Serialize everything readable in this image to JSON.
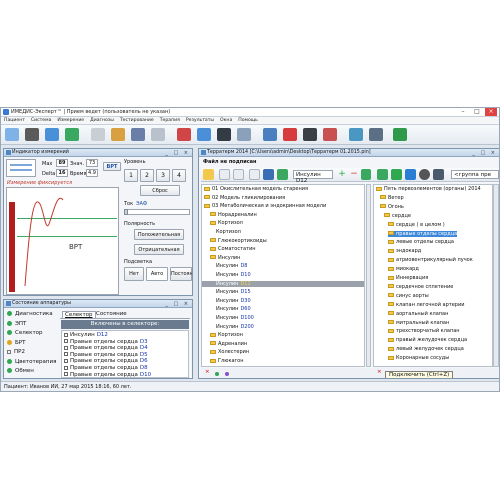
{
  "window": {
    "title": "ИМЕДИС-Эксперт™ | Прием ведет (пользователь не указан)"
  },
  "menu": [
    "Пациент",
    "Система",
    "Измерение",
    "Диагнозы",
    "Тестирование",
    "Терапия",
    "Результаты",
    "Окна",
    "Помощь"
  ],
  "indicator": {
    "title": "Индикатор измерений",
    "max_label": "Max",
    "max_value": "89",
    "value_label": "Знач.",
    "value_value": "73",
    "delta_label": "Delta",
    "delta_value": "16",
    "time_label": "Время",
    "time_value": "4.9",
    "brt_label": "ВРТ",
    "fixing_text": "Измерение фиксируется",
    "graph_label": "ВРТ",
    "level_label": "Уровень",
    "level_buttons": [
      "1",
      "2",
      "3",
      "4"
    ],
    "reset_label": "Сброс",
    "tok_label": "Ток",
    "eaf_label": "ЭАФ",
    "polarity_label": "Полярность",
    "positive_label": "Положительная",
    "negative_label": "Отрицательная",
    "backlight_label": "Подсветка",
    "backlight_options": [
      "Нет",
      "Авто",
      "Постоян."
    ]
  },
  "equipment": {
    "title": "Состояние аппаратуры",
    "items": [
      {
        "label": "Диагностика",
        "color": "#2fa84f"
      },
      {
        "label": "ЭПТ",
        "color": "#2fa84f"
      },
      {
        "label": "Селектор",
        "color": "#2fa84f"
      },
      {
        "label": "БРТ",
        "color": "#e0a51b"
      },
      {
        "label": "ПР2",
        "color": ""
      },
      {
        "label": "Цветотерапия",
        "color": "#2fa84f"
      },
      {
        "label": "Обмен",
        "color": "#2fa84f"
      }
    ],
    "tabs": [
      "Селектор",
      "Состояние"
    ],
    "selector_header": "Включены в селекторе:",
    "selector_items": [
      {
        "a": "Инсулин",
        "b": "D12"
      },
      {
        "a": "Правые отделы сердца",
        "b": "D3"
      },
      {
        "a": "Правые отделы сердца",
        "b": "D4"
      },
      {
        "a": "Правые отделы сердца",
        "b": "D5"
      },
      {
        "a": "Правые отделы сердца",
        "b": "D6"
      },
      {
        "a": "Правые отделы сердца",
        "b": "D8"
      },
      {
        "a": "Правые отделы сердца",
        "b": "D10"
      }
    ]
  },
  "terrain": {
    "title": "Терратерм 2014 [C:\\Users\\admin\\Desktop\\Терратерм 01.2015.pin]",
    "file_status": "Файл не подписан",
    "left_field": "Инсулин D12",
    "left_tree": [
      {
        "text": "01 Окислительная модель старения",
        "indent": 0,
        "folder": true,
        "color": ""
      },
      {
        "text": "02 Модель гликилирования",
        "indent": 0,
        "folder": true,
        "color": ""
      },
      {
        "text": "03 Метаболическая и эндокринная модели",
        "indent": 0,
        "folder": true,
        "color": ""
      },
      {
        "text": "Норадреналин",
        "indent": 1,
        "folder": true,
        "color": ""
      },
      {
        "text": "Кортизол",
        "indent": 1,
        "folder": true,
        "color": ""
      },
      {
        "text": "Кортизол",
        "indent": 2,
        "folder": false,
        "color": ""
      },
      {
        "text": "Глюкокортикоиды",
        "indent": 1,
        "folder": true,
        "color": ""
      },
      {
        "text": "Соматостатин",
        "indent": 1,
        "folder": true,
        "color": ""
      },
      {
        "text": "Инсулин",
        "indent": 1,
        "folder": true,
        "color": ""
      },
      {
        "text": "Инсулин",
        "indent": 2,
        "folder": false,
        "color": "",
        "code": "D8"
      },
      {
        "text": "Инсулин",
        "indent": 2,
        "folder": false,
        "color": "",
        "code": "D10"
      },
      {
        "text": "Инсулин",
        "indent": 2,
        "folder": false,
        "color": "",
        "code": "D12",
        "selected": true
      },
      {
        "text": "Инсулин",
        "indent": 2,
        "folder": false,
        "color": "",
        "code": "D15"
      },
      {
        "text": "Инсулин",
        "indent": 2,
        "folder": false,
        "color": "",
        "code": "D30"
      },
      {
        "text": "Инсулин",
        "indent": 2,
        "folder": false,
        "color": "",
        "code": "D60"
      },
      {
        "text": "Инсулин",
        "indent": 2,
        "folder": false,
        "color": "",
        "code": "D100"
      },
      {
        "text": "Инсулин",
        "indent": 2,
        "folder": false,
        "color": "",
        "code": "D200"
      },
      {
        "text": "Кортизон",
        "indent": 1,
        "folder": true,
        "color": ""
      },
      {
        "text": "Адреналин",
        "indent": 1,
        "folder": true,
        "color": ""
      },
      {
        "text": "Холестерин",
        "indent": 1,
        "folder": true,
        "color": ""
      },
      {
        "text": "Глюкагон",
        "indent": 1,
        "folder": true,
        "color": ""
      }
    ],
    "right_field": "<группа пре",
    "right_tree": [
      {
        "text": "Пять первоэлементов (органы) 2014",
        "indent": 0,
        "selected": false
      },
      {
        "text": "Ветер",
        "indent": 1,
        "selected": false
      },
      {
        "text": "Огонь",
        "indent": 1,
        "selected": false
      },
      {
        "text": "сердце",
        "indent": 2,
        "selected": false
      },
      {
        "text": "сердце ( в целом )",
        "indent": 3,
        "selected": false
      },
      {
        "text": "правые отделы сердца",
        "indent": 3,
        "selected": true
      },
      {
        "text": "левые отделы сердца",
        "indent": 3,
        "selected": false
      },
      {
        "text": "эндокард",
        "indent": 3,
        "selected": false
      },
      {
        "text": "атриовентрикулярный пучок",
        "indent": 3,
        "selected": false
      },
      {
        "text": "миокард",
        "indent": 3,
        "selected": false
      },
      {
        "text": "Иннервация",
        "indent": 3,
        "selected": false
      },
      {
        "text": "сердечное сплетение",
        "indent": 3,
        "selected": false
      },
      {
        "text": "синус аорты",
        "indent": 3,
        "selected": false
      },
      {
        "text": "клапан легочной артерии",
        "indent": 3,
        "selected": false
      },
      {
        "text": "аортальный клапан",
        "indent": 3,
        "selected": false
      },
      {
        "text": "митральный клапан",
        "indent": 3,
        "selected": false
      },
      {
        "text": "трехстворчатый клапан",
        "indent": 3,
        "selected": false
      },
      {
        "text": "правый желудочек сердца",
        "indent": 3,
        "selected": false
      },
      {
        "text": "левый желудочек сердца",
        "indent": 3,
        "selected": false
      },
      {
        "text": "Коронарные сосуды",
        "indent": 3,
        "selected": false
      }
    ],
    "tooltip": "Подключить (Ctrl+Z)"
  },
  "status": {
    "text": "Пациент: Иванов ИИ, 27 мар 2015 18:16, 60 лет."
  }
}
